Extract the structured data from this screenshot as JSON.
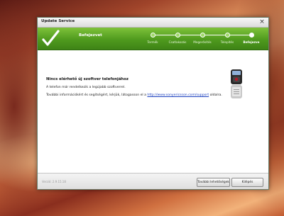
{
  "window": {
    "title": "Update Service",
    "close_glyph": "×"
  },
  "header": {
    "current_step": "Befejezvet",
    "accent_color": "#4f9a1e",
    "steps": [
      {
        "label": "Termék",
        "state": "done"
      },
      {
        "label": "Csatlakozás",
        "state": "done"
      },
      {
        "label": "Megerősítés",
        "state": "done"
      },
      {
        "label": "Telepítés",
        "state": "done"
      },
      {
        "label": "Befejezve",
        "state": "active"
      }
    ]
  },
  "content": {
    "title": "Nincs elérhető új szoftver telefonjához",
    "line1": "A telefon már rendelkezik a legújabb szoftverrel.",
    "line2_prefix": "További információkért és segítségért, kérjük, látogasson el a ",
    "link_text": "http://www.sonyericsson.com/support",
    "line2_suffix": " oldalra.",
    "device_icon": "phone-icon",
    "status_icon": "checkmark-icon"
  },
  "footer": {
    "version": "Verzió: 2.9.15.18",
    "more_info_label": "További lehetőségek",
    "exit_label": "Kilépés"
  }
}
